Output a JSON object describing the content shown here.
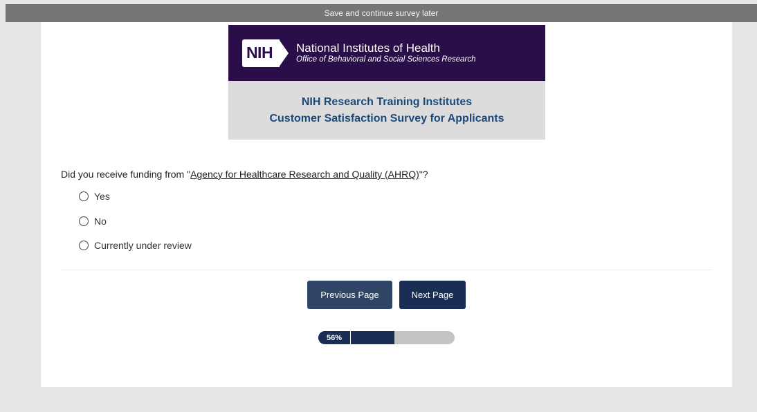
{
  "topbar": {
    "save_later": "Save and continue survey later"
  },
  "banner": {
    "logo_text": "NIH",
    "org_name": "National Institutes of Health",
    "office_name": "Office of Behavioral and Social Sciences Research",
    "survey_line1": "NIH Research Training Institutes",
    "survey_line2": "Customer Satisfaction Survey for Applicants"
  },
  "question": {
    "prefix": "Did you receive funding from \"",
    "link_text": "Agency for Healthcare Research and Quality (AHRQ)",
    "suffix": "\"?",
    "options": [
      "Yes",
      "No",
      "Currently under review"
    ]
  },
  "nav": {
    "previous_label": "Previous Page",
    "next_label": "Next Page"
  },
  "progress": {
    "percent": 56,
    "label": "56%"
  },
  "colors": {
    "banner_dark": "#2a0e4a",
    "banner_text": "#1b4a7a",
    "button_primary": "#1a2e55",
    "button_secondary": "#2f4566",
    "topbar": "#767676"
  }
}
